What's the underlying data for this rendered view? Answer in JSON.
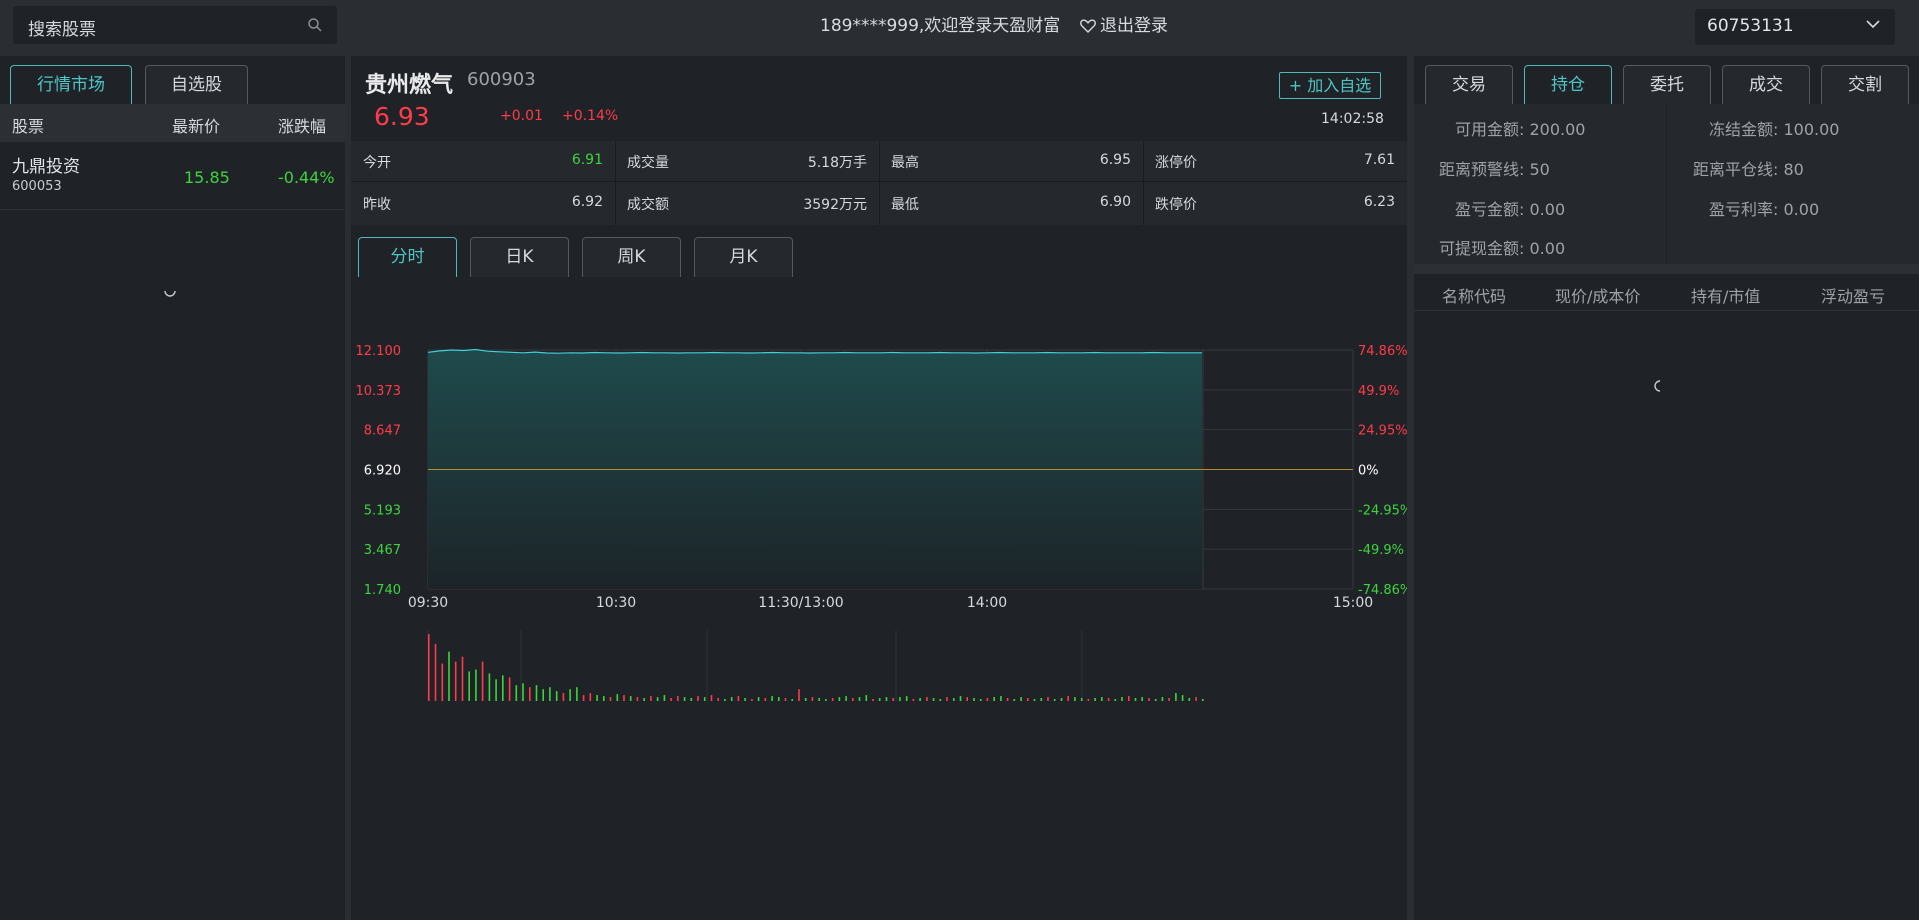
{
  "header": {
    "search_placeholder": "搜索股票",
    "welcome": "189****999,欢迎登录天盈财富",
    "logout": "退出登录",
    "account": "60753131"
  },
  "left": {
    "tabs": [
      "行情市场",
      "自选股"
    ],
    "columns": [
      "股票",
      "最新价",
      "涨跌幅"
    ],
    "rows": [
      {
        "name": "九鼎投资",
        "code": "600053",
        "price": "15.85",
        "change": "-0.44%"
      }
    ]
  },
  "stock": {
    "name": "贵州燃气",
    "code": "600903",
    "add_watch": "+ 加入自选",
    "price": "6.93",
    "change": "+0.01",
    "change_pct": "+0.14%",
    "time": "14:02:58",
    "stats": [
      {
        "label": "今开",
        "value": "6.91"
      },
      {
        "label": "成交量",
        "value": "5.18万手"
      },
      {
        "label": "最高",
        "value": "6.95"
      },
      {
        "label": "涨停价",
        "value": "7.61"
      },
      {
        "label": "昨收",
        "value": "6.92"
      },
      {
        "label": "成交额",
        "value": "3592万元"
      },
      {
        "label": "最低",
        "value": "6.90"
      },
      {
        "label": "跌停价",
        "value": "6.23"
      }
    ]
  },
  "chart_tabs": [
    "分时",
    "日K",
    "周K",
    "月K"
  ],
  "chart_data": {
    "type": "line",
    "prev_close": 6.92,
    "y_ticks_left": [
      "12.100",
      "10.373",
      "8.647",
      "6.920",
      "5.193",
      "3.467",
      "1.740"
    ],
    "y_ticks_right": [
      "74.86%",
      "49.9%",
      "24.95%",
      "0%",
      "-24.95%",
      "-49.9%",
      "-74.86%"
    ],
    "x_ticks": [
      "09:30",
      "10:30",
      "11:30/13:00",
      "14:00",
      "15:00"
    ],
    "ylim": [
      1.74,
      12.1
    ],
    "price_series": [
      12.0,
      12.06,
      12.1,
      12.08,
      12.12,
      12.05,
      12.02,
      12.0,
      11.98,
      12.01,
      11.97,
      11.96,
      11.98,
      11.97,
      11.99,
      11.98,
      11.97,
      11.98,
      11.99,
      11.98,
      11.98,
      11.97,
      11.98,
      11.98,
      11.99,
      11.98,
      11.98,
      11.97,
      11.98,
      11.99,
      11.98,
      11.98,
      11.97,
      11.98,
      11.98,
      11.99,
      11.98,
      11.98,
      11.98,
      11.99,
      11.98,
      11.98,
      11.98,
      11.99,
      11.98,
      11.98,
      11.97,
      11.98,
      11.99,
      11.98,
      11.98,
      11.98,
      11.99,
      11.98,
      11.98,
      11.98,
      11.99,
      11.98,
      11.98,
      11.98,
      11.98,
      11.99,
      11.98,
      11.98,
      11.98,
      11.98
    ],
    "volume_series": [
      68,
      58,
      38,
      50,
      40,
      45,
      30,
      32,
      40,
      28,
      22,
      26,
      24,
      16,
      18,
      14,
      16,
      12,
      14,
      10,
      8,
      12,
      14,
      6,
      8,
      6,
      5,
      4,
      7,
      6,
      5,
      4,
      3,
      5,
      4,
      6,
      3,
      5,
      4,
      3,
      5,
      4,
      6,
      3,
      2,
      4,
      5,
      3,
      2,
      4,
      3,
      5,
      4,
      3,
      2,
      12,
      3,
      4,
      3,
      2,
      3,
      4,
      5,
      3,
      4,
      6,
      2,
      3,
      4,
      3,
      4,
      5,
      2,
      3,
      4,
      3,
      2,
      4,
      3,
      5,
      4,
      3,
      2,
      3,
      4,
      5,
      3,
      2,
      4,
      3,
      2,
      3,
      4,
      2,
      3,
      5,
      4,
      3,
      2,
      3,
      4,
      3,
      2,
      4,
      5,
      3,
      4,
      3,
      2,
      4,
      3,
      8,
      6,
      3,
      4,
      2
    ],
    "volume_up": [
      true,
      true,
      true,
      false,
      true,
      true,
      false,
      false,
      true,
      false,
      false,
      false,
      true,
      false,
      false,
      true,
      false,
      false,
      false,
      false,
      true,
      false,
      false,
      true,
      true,
      false,
      false,
      true,
      false,
      true,
      false,
      true,
      false,
      true,
      false,
      false,
      true,
      true,
      false,
      false,
      true,
      false,
      true,
      true,
      false,
      false,
      true,
      false,
      true,
      false,
      true,
      false,
      false,
      true,
      false,
      true,
      false,
      true,
      false,
      false,
      true,
      false,
      false,
      true,
      false,
      false,
      true,
      false,
      false,
      true,
      false,
      false,
      true,
      false,
      true,
      false,
      false,
      true,
      false,
      false,
      true,
      false,
      false,
      true,
      false,
      false,
      true,
      false,
      false,
      true,
      false,
      false,
      true,
      false,
      false,
      true,
      false,
      false,
      true,
      false,
      false,
      true,
      false,
      false,
      true,
      false,
      false,
      true,
      false,
      false,
      true,
      false,
      false,
      false,
      true,
      false
    ]
  },
  "right": {
    "tabs": [
      "交易",
      "持仓",
      "委托",
      "成交",
      "交割"
    ],
    "info": [
      {
        "label": "可用金额:",
        "value": "200.00"
      },
      {
        "label": "冻结金额:",
        "value": "100.00"
      },
      {
        "label": "距离预警线:",
        "value": "50"
      },
      {
        "label": "距离平仓线:",
        "value": "80"
      },
      {
        "label": "盈亏金额:",
        "value": "0.00"
      },
      {
        "label": "盈亏利率:",
        "value": "0.00"
      },
      {
        "label": "可提现金额:",
        "value": "0.00"
      }
    ],
    "columns": [
      "名称代码",
      "现价/成本价",
      "持有/市值",
      "浮动盈亏"
    ]
  },
  "colors": {
    "accent": "#4fc6c6",
    "up": "#ff3b4a",
    "down": "#3ed43e",
    "price_line": "#3fd0d8",
    "prev_close_line": "#b88a2e"
  }
}
